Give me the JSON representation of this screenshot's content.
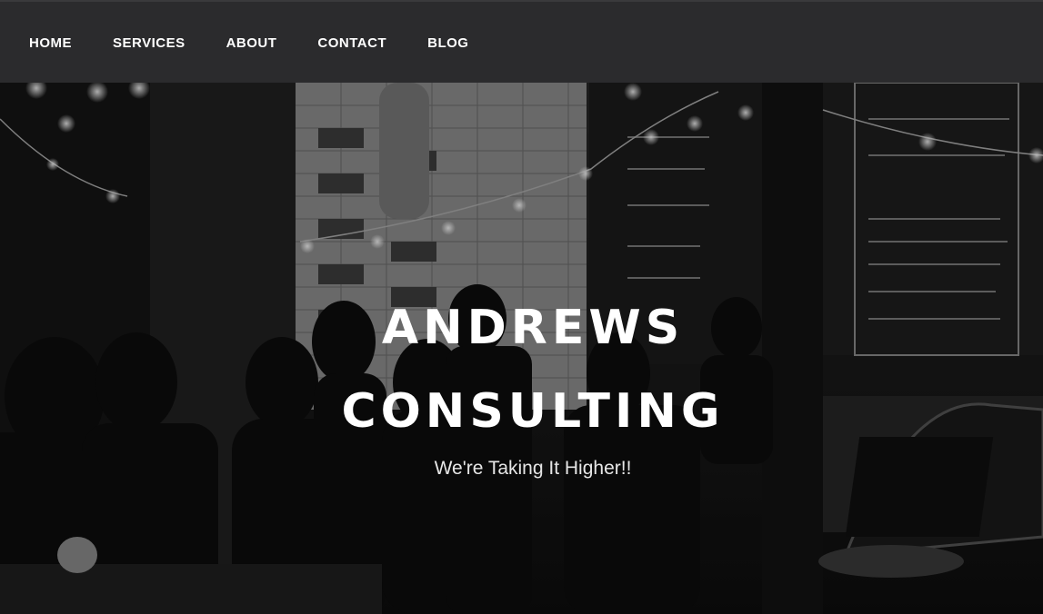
{
  "nav": {
    "items": [
      {
        "label": "HOME"
      },
      {
        "label": "SERVICES"
      },
      {
        "label": "ABOUT"
      },
      {
        "label": "CONTACT"
      },
      {
        "label": "BLOG"
      }
    ]
  },
  "hero": {
    "title_line1": "ANDREWS",
    "title_line2": "CONSULTING",
    "tagline": "We're Taking It Higher!!"
  },
  "colors": {
    "nav_background": "#2b2b2d",
    "nav_text": "#ffffff",
    "hero_text": "#ffffff"
  }
}
